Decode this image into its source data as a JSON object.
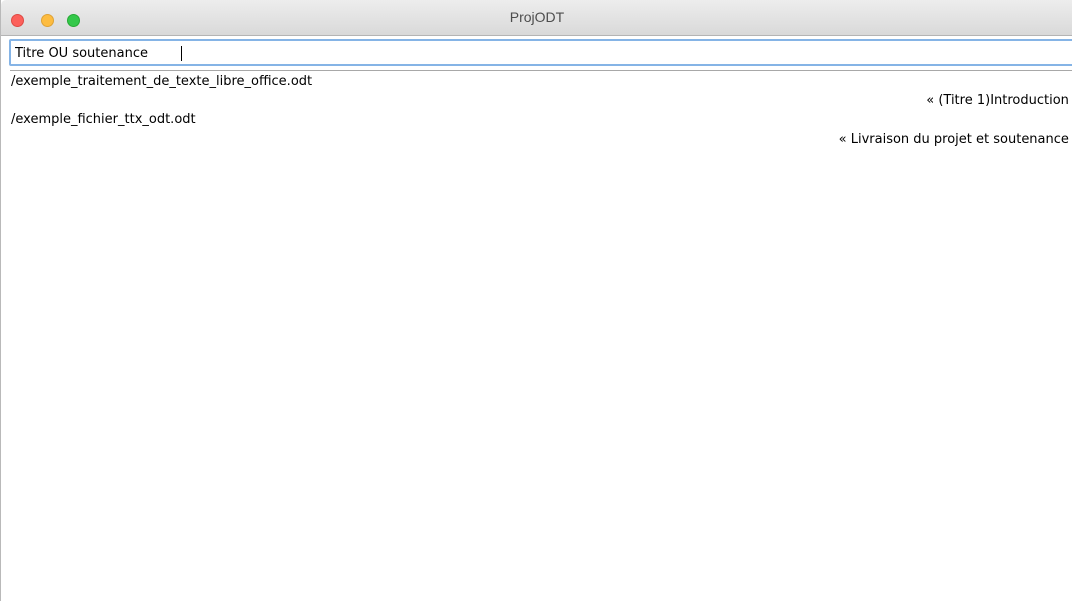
{
  "window": {
    "title": "ProjODT"
  },
  "search": {
    "value": "Titre OU soutenance"
  },
  "results": [
    {
      "path": "/exemple_traitement_de_texte_libre_office.odt",
      "match": "« (Titre 1)Introduction »"
    },
    {
      "path": "/exemple_fichier_ttx_odt.odt",
      "match": "« Livraison du projet et soutenance »"
    }
  ]
}
